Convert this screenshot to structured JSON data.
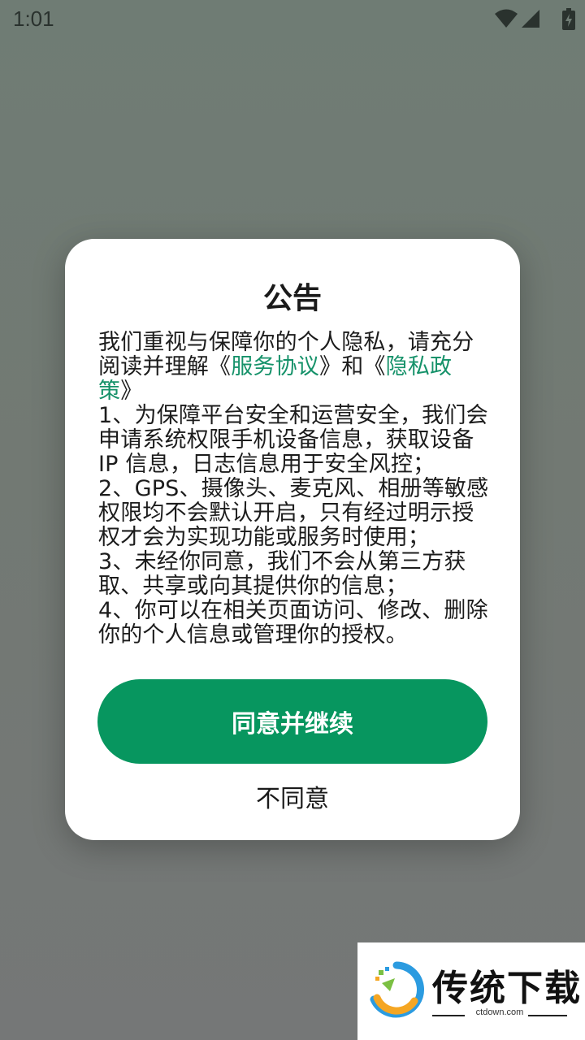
{
  "status_bar": {
    "time": "1:01"
  },
  "dialog": {
    "title": "公告",
    "intro_a": "我们重视与保障你的个人隐私，请充分阅读并理解《",
    "link_service": "服务协议",
    "intro_b": "》和《",
    "link_privacy": "隐私政策",
    "intro_c": "》",
    "item1": "1、为保障平台安全和运营安全，我们会申请系统权限手机设备信息，获取设备 IP 信息，日志信息用于安全风控；",
    "item2": "2、GPS、摄像头、麦克风、相册等敏感权限均不会默认开启，只有经过明示授权才会为实现功能或服务时使用；",
    "item3": "3、未经你同意，我们不会从第三方获取、共享或向其提供你的信息；",
    "item4": "4、你可以在相关页面访问、修改、删除你的个人信息或管理你的授权。",
    "agree_label": "同意并继续",
    "disagree_label": "不同意"
  },
  "watermark": {
    "brand": "传统下载",
    "url": "ctdown.com"
  },
  "colors": {
    "accent": "#07965f",
    "link": "#16926a",
    "overlay": "#727973"
  }
}
